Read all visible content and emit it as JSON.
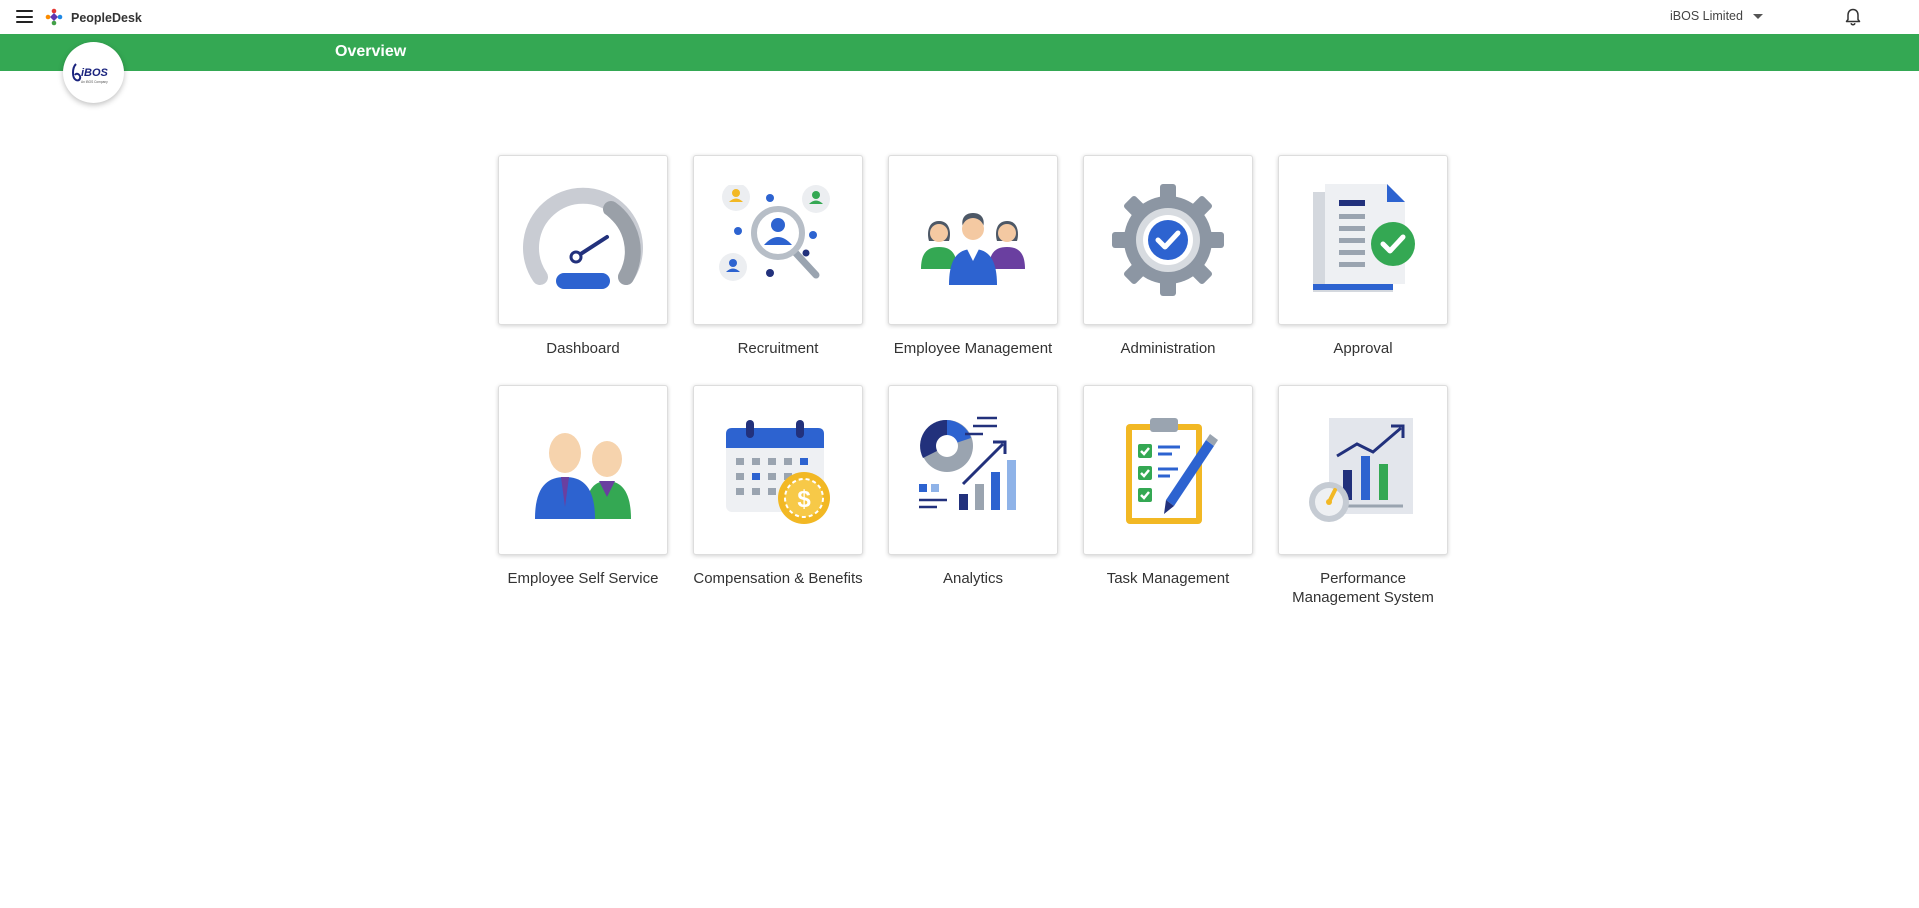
{
  "app": {
    "name": "PeopleDesk"
  },
  "header": {
    "organization": "iBOS Limited"
  },
  "greenbar": {
    "title": "Overview"
  },
  "org_badge": {
    "text": "iBOS",
    "subtext": "An iBOS Company"
  },
  "colors": {
    "accent": "#34a853",
    "blue": "#2d63d0",
    "navy": "#22317c",
    "gray": "#9aa4b0",
    "gold": "#f2b824"
  },
  "modules": [
    {
      "label": "Dashboard",
      "icon": "speedometer-icon"
    },
    {
      "label": "Recruitment",
      "icon": "candidate-search-icon"
    },
    {
      "label": "Employee Management",
      "icon": "team-icon"
    },
    {
      "label": "Administration",
      "icon": "gear-check-icon"
    },
    {
      "label": "Approval",
      "icon": "document-approved-icon"
    },
    {
      "label": "Employee Self Service",
      "icon": "employees-icon"
    },
    {
      "label": "Compensation & Benefits",
      "icon": "calendar-coin-icon"
    },
    {
      "label": "Analytics",
      "icon": "analytics-chart-icon"
    },
    {
      "label": "Task Management",
      "icon": "clipboard-checklist-icon"
    },
    {
      "label": "Performance Management System",
      "icon": "performance-chart-icon"
    }
  ]
}
